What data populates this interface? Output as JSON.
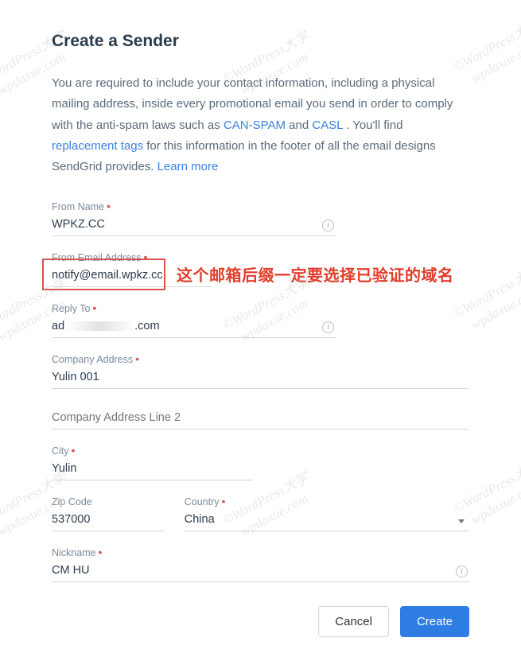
{
  "heading": "Create a Sender",
  "intro": {
    "t1": "You are required to include your contact information, including a physical mailing address, inside every promotional email you send in order to comply with the anti-spam laws such as ",
    "link1": "CAN-SPAM",
    "t2": " and ",
    "link2": "CASL",
    "t3": ". You'll find ",
    "link3": "replacement tags",
    "t4": " for this information in the footer of all the email designs SendGrid provides. ",
    "link4": "Learn more"
  },
  "fields": {
    "fromName": {
      "label": "From Name",
      "value": "WPKZ.CC"
    },
    "fromEmail": {
      "label": "From Email Address",
      "value": "notify@email.wpkz.cc"
    },
    "replyTo": {
      "label": "Reply To",
      "prefix": "ad",
      "suffix": ".com"
    },
    "companyAddress": {
      "label": "Company Address",
      "value": "Yulin 001"
    },
    "companyAddress2": {
      "label": "Company Address Line 2",
      "value": ""
    },
    "city": {
      "label": "City",
      "value": "Yulin"
    },
    "zip": {
      "label": "Zip Code",
      "value": "537000"
    },
    "country": {
      "label": "Country",
      "value": "China"
    },
    "nickname": {
      "label": "Nickname",
      "value": "CM HU"
    }
  },
  "annotation": "这个邮箱后缀一定要选择已验证的域名",
  "buttons": {
    "cancel": "Cancel",
    "create": "Create"
  },
  "watermark": {
    "line1": "©WordPress大学",
    "line2": "wpdaxue.com"
  },
  "infoGlyph": "i"
}
